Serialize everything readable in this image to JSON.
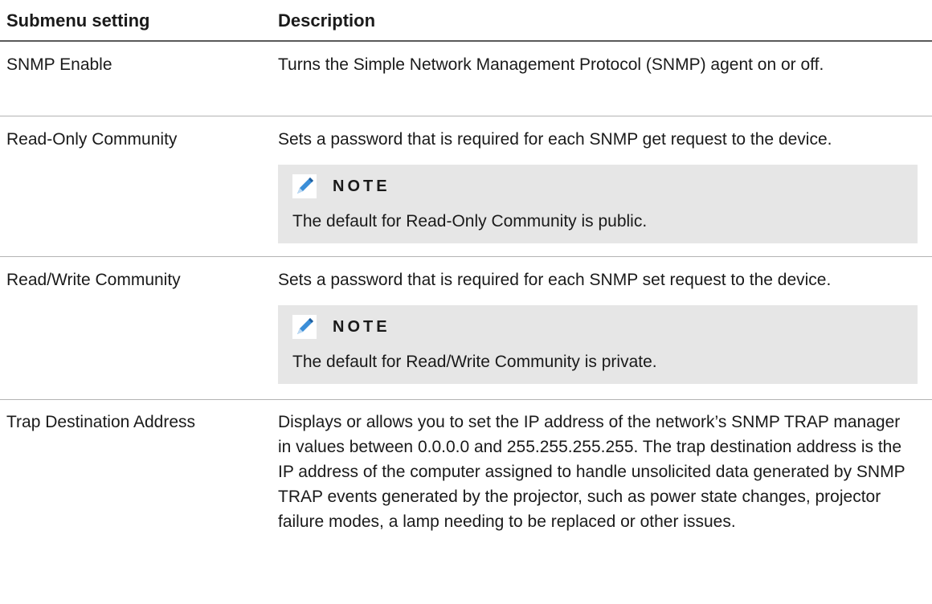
{
  "header": {
    "setting": "Submenu setting",
    "description": "Description"
  },
  "rows": [
    {
      "setting": "SNMP Enable",
      "description": "Turns the Simple Network Management Protocol (SNMP) agent on or off."
    },
    {
      "setting": "Read-Only Community",
      "description": "Sets a password that is required for each SNMP get request to the device.",
      "note": {
        "label": "NOTE",
        "text": "The default for Read-Only Community is public."
      }
    },
    {
      "setting": "Read/Write Community",
      "description": "Sets a password that is required for each SNMP set request to the device.",
      "note": {
        "label": "NOTE",
        "text": "The default for Read/Write Community is private."
      }
    },
    {
      "setting": "Trap Destination Address",
      "description": "Displays or allows you to set the IP address of the network’s SNMP TRAP manager in values between 0.0.0.0 and 255.255.255.255. The trap destination address is the IP address of the computer assigned to handle unsolicited data generated by SNMP TRAP events generated by the projector, such as power state changes, projector failure modes, a lamp needing to be replaced or other issues."
    }
  ],
  "icons": {
    "note": "pencil-icon",
    "note_color": "#3b8ed8"
  }
}
